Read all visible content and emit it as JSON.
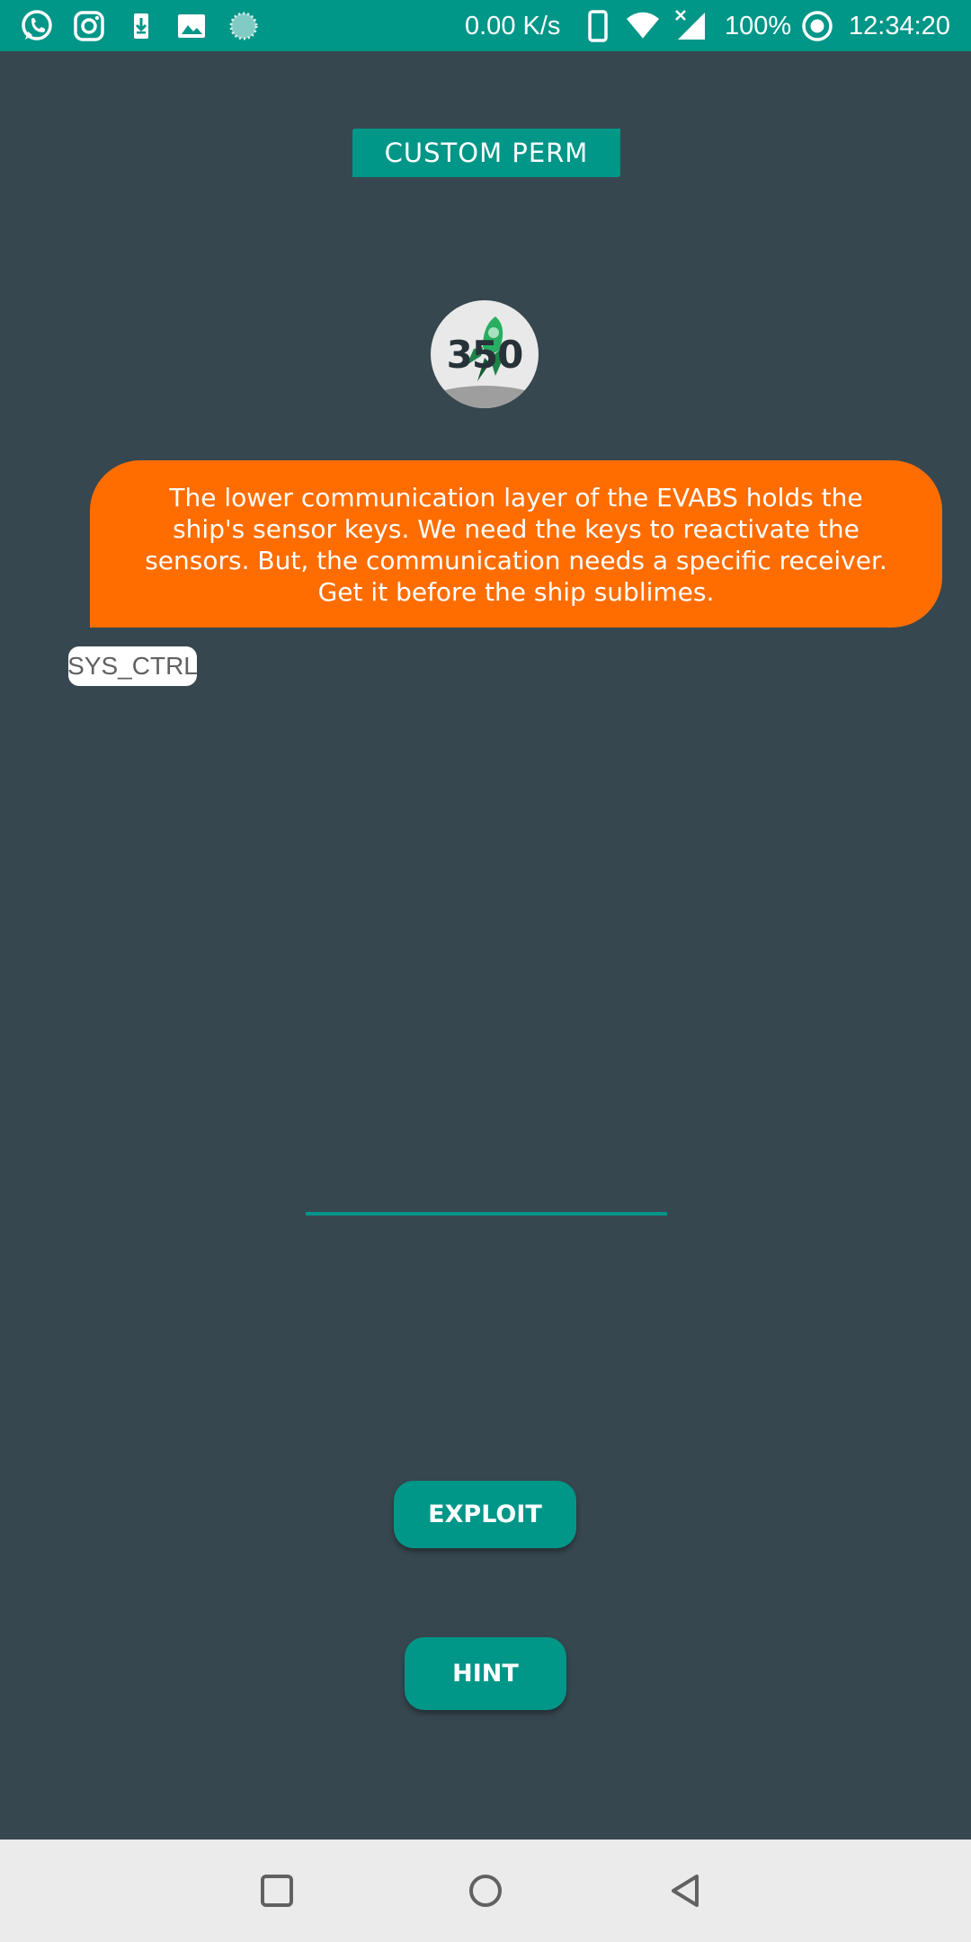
{
  "status_bar": {
    "network_speed": "0.00 K/s",
    "battery": "100%",
    "time": "12:34:20",
    "icons": [
      "whatsapp-icon",
      "instagram-icon",
      "download-icon",
      "gallery-icon",
      "loading-icon",
      "phone-icon",
      "wifi-icon",
      "signal-icon",
      "record-icon"
    ]
  },
  "header": {
    "title": "CUSTOM PERM"
  },
  "badge": {
    "score": "350",
    "icon": "rocket-icon"
  },
  "message": {
    "text": "The lower communication layer of the EVABS holds the ship's sensor keys. We need the keys to reactivate the sensors. But, the communication needs a specific receiver. Get it before the ship sublimes."
  },
  "tag": {
    "label": "SYS_CTRL"
  },
  "input": {
    "value": "",
    "placeholder": ""
  },
  "buttons": {
    "exploit_label": "EXPLOIT",
    "hint_label": "HINT"
  },
  "nav_bar": {
    "icons": [
      "recents-icon",
      "home-icon",
      "back-icon"
    ]
  },
  "colors": {
    "accent": "#009688",
    "background": "#37474f",
    "message": "#ff6d00",
    "nav_bar": "#ebebeb"
  }
}
